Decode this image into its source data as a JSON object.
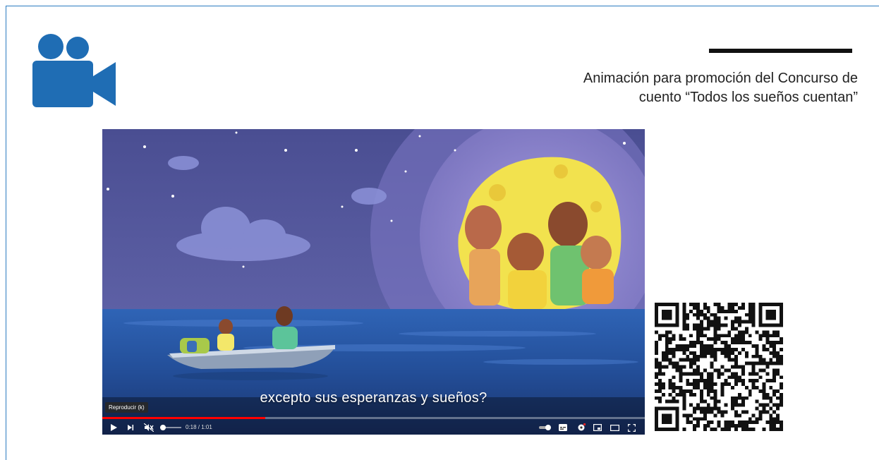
{
  "header": {
    "icon": "video-camera-icon",
    "caption_line1": "Animación para promoción del  Concurso de",
    "caption_line2": "cuento “Todos los sueños cuentan”"
  },
  "video": {
    "subtitle": "excepto sus esperanzas y sueños?",
    "tooltip": "Reproducir (k)",
    "time": "0:18 / 1:01",
    "progress": 0.3,
    "volume_muted": true,
    "controls": [
      "play-icon",
      "next-icon",
      "mute-icon",
      "autoplay-toggle-icon",
      "subtitles-icon",
      "settings-icon",
      "miniplayer-icon",
      "theater-icon",
      "fullscreen-icon"
    ]
  },
  "colors": {
    "brand_blue": "#1f6db4",
    "frame_line": "#2b7bc0",
    "progress_red": "#ff0000"
  },
  "qr": {
    "icon": "qr-code-icon"
  }
}
